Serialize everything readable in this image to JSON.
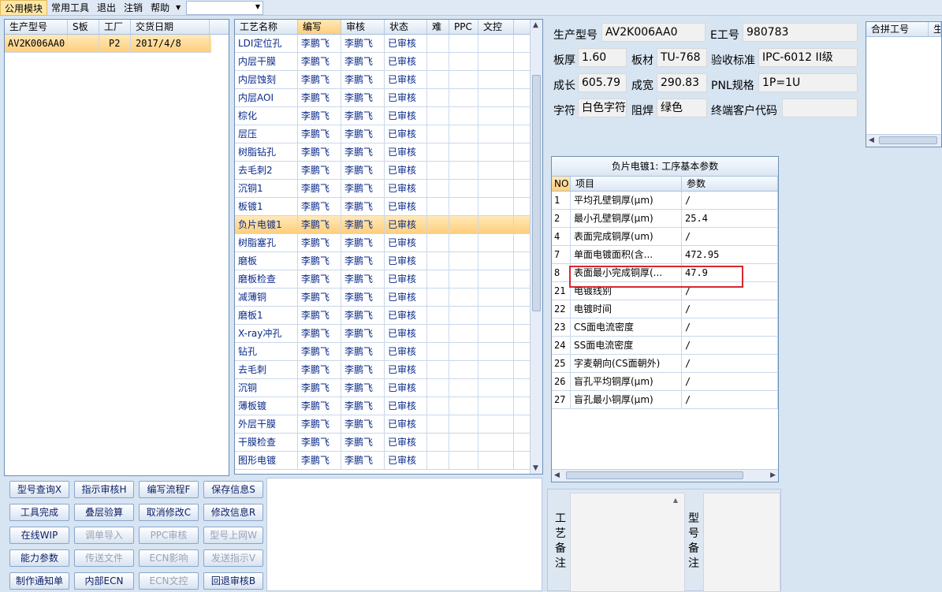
{
  "menubar": {
    "items": [
      "公用模块",
      "常用工具",
      "退出",
      "注销",
      "帮助"
    ]
  },
  "orders": {
    "headers": [
      "生产型号",
      "S板",
      "工厂",
      "交货日期"
    ],
    "rows": [
      {
        "model": "AV2K006AA0",
        "s": "",
        "factory": "P2",
        "date": "2017/4/8"
      }
    ]
  },
  "processes": {
    "headers": [
      "工艺名称",
      "编写",
      "审核",
      "状态",
      "难",
      "PPC",
      "文控"
    ],
    "selected_index": 10,
    "rows": [
      {
        "name": "LDI定位孔",
        "writer": "李鹏飞",
        "reviewer": "李鹏飞",
        "status": "已审核"
      },
      {
        "name": "内层干膜",
        "writer": "李鹏飞",
        "reviewer": "李鹏飞",
        "status": "已审核"
      },
      {
        "name": "内层蚀刻",
        "writer": "李鹏飞",
        "reviewer": "李鹏飞",
        "status": "已审核"
      },
      {
        "name": "内层AOI",
        "writer": "李鹏飞",
        "reviewer": "李鹏飞",
        "status": "已审核"
      },
      {
        "name": "棕化",
        "writer": "李鹏飞",
        "reviewer": "李鹏飞",
        "status": "已审核"
      },
      {
        "name": "层压",
        "writer": "李鹏飞",
        "reviewer": "李鹏飞",
        "status": "已审核"
      },
      {
        "name": "树脂钻孔",
        "writer": "李鹏飞",
        "reviewer": "李鹏飞",
        "status": "已审核"
      },
      {
        "name": "去毛刺2",
        "writer": "李鹏飞",
        "reviewer": "李鹏飞",
        "status": "已审核"
      },
      {
        "name": "沉铜1",
        "writer": "李鹏飞",
        "reviewer": "李鹏飞",
        "status": "已审核"
      },
      {
        "name": "板镀1",
        "writer": "李鹏飞",
        "reviewer": "李鹏飞",
        "status": "已审核"
      },
      {
        "name": "负片电镀1",
        "writer": "李鹏飞",
        "reviewer": "李鹏飞",
        "status": "已审核"
      },
      {
        "name": "树脂塞孔",
        "writer": "李鹏飞",
        "reviewer": "李鹏飞",
        "status": "已审核"
      },
      {
        "name": "磨板",
        "writer": "李鹏飞",
        "reviewer": "李鹏飞",
        "status": "已审核"
      },
      {
        "name": "磨板检查",
        "writer": "李鹏飞",
        "reviewer": "李鹏飞",
        "status": "已审核"
      },
      {
        "name": "减薄铜",
        "writer": "李鹏飞",
        "reviewer": "李鹏飞",
        "status": "已审核"
      },
      {
        "name": "磨板1",
        "writer": "李鹏飞",
        "reviewer": "李鹏飞",
        "status": "已审核"
      },
      {
        "name": "X-ray冲孔",
        "writer": "李鹏飞",
        "reviewer": "李鹏飞",
        "status": "已审核"
      },
      {
        "name": "钻孔",
        "writer": "李鹏飞",
        "reviewer": "李鹏飞",
        "status": "已审核"
      },
      {
        "name": "去毛刺",
        "writer": "李鹏飞",
        "reviewer": "李鹏飞",
        "status": "已审核"
      },
      {
        "name": "沉铜",
        "writer": "李鹏飞",
        "reviewer": "李鹏飞",
        "status": "已审核"
      },
      {
        "name": "薄板镀",
        "writer": "李鹏飞",
        "reviewer": "李鹏飞",
        "status": "已审核"
      },
      {
        "name": "外层干膜",
        "writer": "李鹏飞",
        "reviewer": "李鹏飞",
        "status": "已审核"
      },
      {
        "name": "干膜检查",
        "writer": "李鹏飞",
        "reviewer": "李鹏飞",
        "status": "已审核"
      },
      {
        "name": "图形电镀",
        "writer": "李鹏飞",
        "reviewer": "李鹏飞",
        "status": "已审核"
      }
    ]
  },
  "info": {
    "model_label": "生产型号",
    "model_value": "AV2K006AA0",
    "eno_label": "E工号",
    "eno_value": "980783",
    "thickness_label": "板厚",
    "thickness_value": "1.60",
    "material_label": "板材",
    "material_value": "TU-768",
    "standard_label": "验收标准",
    "standard_value": "IPC-6012 II级",
    "length_label": "成长",
    "length_value": "605.79",
    "width_label": "成宽",
    "width_value": "290.83",
    "pnl_label": "PNL规格",
    "pnl_value": "1P=1U",
    "char_label": "字符",
    "char_value": "白色字符",
    "mask_label": "阻焊",
    "mask_value": "绿色",
    "customer_label": "终端客户代码",
    "customer_value": ""
  },
  "merge": {
    "headers": [
      "合拼工号",
      "生"
    ]
  },
  "params": {
    "title": "负片电镀1: 工序基本参数",
    "headers": [
      "NO",
      "项目",
      "参数"
    ],
    "rows": [
      {
        "no": "1",
        "item": "平均孔壁铜厚(μm)",
        "value": "/"
      },
      {
        "no": "2",
        "item": "最小孔壁铜厚(μm)",
        "value": "25.4"
      },
      {
        "no": "4",
        "item": "表面完成铜厚(um)",
        "value": "/"
      },
      {
        "no": "7",
        "item": "单面电镀面积(含...",
        "value": "472.95"
      },
      {
        "no": "8",
        "item": "表面最小完成铜厚(...",
        "value": "47.9"
      },
      {
        "no": "21",
        "item": "电镀线别",
        "value": "/"
      },
      {
        "no": "22",
        "item": "电镀时间",
        "value": "/"
      },
      {
        "no": "23",
        "item": "CS面电流密度",
        "value": "/"
      },
      {
        "no": "24",
        "item": "SS面电流密度",
        "value": "/"
      },
      {
        "no": "25",
        "item": "字麦朝向(CS面朝外)",
        "value": "/"
      },
      {
        "no": "26",
        "item": "盲孔平均铜厚(μm)",
        "value": "/"
      },
      {
        "no": "27",
        "item": "盲孔最小铜厚(μm)",
        "value": "/"
      }
    ]
  },
  "buttons": [
    {
      "label": "型号查询X",
      "enabled": true
    },
    {
      "label": "指示审核H",
      "enabled": true
    },
    {
      "label": "编写流程F",
      "enabled": true
    },
    {
      "label": "保存信息S",
      "enabled": true
    },
    {
      "label": "工具完成",
      "enabled": true
    },
    {
      "label": "叠层验算",
      "enabled": true
    },
    {
      "label": "取消修改C",
      "enabled": true
    },
    {
      "label": "修改信息R",
      "enabled": true
    },
    {
      "label": "在线WIP",
      "enabled": true
    },
    {
      "label": "调单导入",
      "enabled": false
    },
    {
      "label": "PPC审核",
      "enabled": false
    },
    {
      "label": "型号上网W",
      "enabled": false
    },
    {
      "label": "能力参数",
      "enabled": true
    },
    {
      "label": "传送文件",
      "enabled": false
    },
    {
      "label": "ECN影响",
      "enabled": false
    },
    {
      "label": "发送指示V",
      "enabled": false
    },
    {
      "label": "制作通知单",
      "enabled": true
    },
    {
      "label": "内部ECN",
      "enabled": true
    },
    {
      "label": "ECN文控",
      "enabled": false
    },
    {
      "label": "回退审核B",
      "enabled": true
    }
  ],
  "remarks": {
    "process_label": "工艺备注",
    "model_label": "型号备注"
  },
  "colors": {
    "selection": "#ffcf7c",
    "highlight_border": "#d9272e",
    "button_text": "#0c1f66"
  }
}
